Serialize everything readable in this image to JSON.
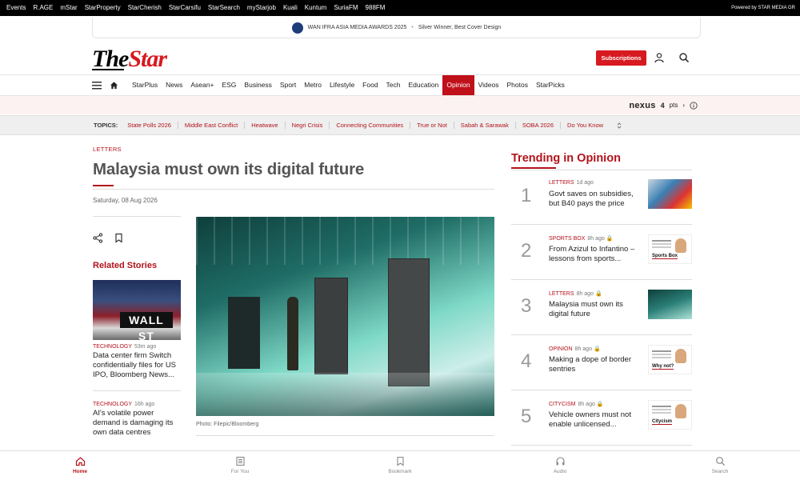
{
  "topbar": {
    "links": [
      "Events",
      "R.AGE",
      "mStar",
      "StarProperty",
      "StarCherish",
      "StarCarsifu",
      "StarSearch",
      "myStarjob",
      "Kuali",
      "Kuntum",
      "SuriaFM",
      "988FM"
    ],
    "powered_by": "Powered by STAR MEDIA GR"
  },
  "award_banner": {
    "title": "WAN IFRA ASIA MEDIA AWARDS 2025",
    "separator": "•",
    "subtitle": "Silver Winner, Best Cover Design"
  },
  "header": {
    "logo_the": "The",
    "logo_star": "Star",
    "subscriptions_label": "Subscriptions"
  },
  "nav": {
    "items": [
      "StarPlus",
      "News",
      "Asean+",
      "ESG",
      "Business",
      "Sport",
      "Metro",
      "Lifestyle",
      "Food",
      "Tech",
      "Education",
      "Opinion",
      "Videos",
      "Photos",
      "StarPicks"
    ],
    "active": "Opinion"
  },
  "nexus": {
    "brand": "nexus",
    "points": "4",
    "points_label": "pts",
    "arrow": "›"
  },
  "topics": {
    "label": "TOPICS:",
    "items": [
      "State Polls 2026",
      "Middle East Conflict",
      "Heatwave",
      "Negri Crisis",
      "Connecting Communities",
      "True or Not",
      "Sabah & Sarawak",
      "SOBA 2026",
      "Do You Know"
    ]
  },
  "article": {
    "kicker": "LETTERS",
    "headline": "Malaysia must own its digital future",
    "date": "Saturday, 08 Aug 2026",
    "photo_caption": "Photo: Filepic/Bloomberg"
  },
  "related": {
    "title": "Related Stories",
    "thumb_sign": "WALL ST",
    "items": [
      {
        "tag": "TECHNOLOGY",
        "ago": "53m ago",
        "title": "Data center firm Switch confidentially files for US IPO, Bloomberg News..."
      },
      {
        "tag": "TECHNOLOGY",
        "ago": "16h ago",
        "title": "AI's volatile power demand is damaging its own data centres"
      }
    ]
  },
  "trending": {
    "title": "Trending in Opinion",
    "items": [
      {
        "num": "1",
        "tag": "LETTERS",
        "ago": "1d ago",
        "locked": false,
        "title": "Govt saves on subsidies, but B40 pays the price"
      },
      {
        "num": "2",
        "tag": "SPORTS BOX",
        "ago": "8h ago",
        "locked": true,
        "title": "From Azizul to Infantino – lessons from sports...",
        "thumb_label": "Sports Box"
      },
      {
        "num": "3",
        "tag": "LETTERS",
        "ago": "8h ago",
        "locked": true,
        "title": "Malaysia must own its digital future"
      },
      {
        "num": "4",
        "tag": "OPINION",
        "ago": "8h ago",
        "locked": true,
        "title": "Making a dope of border sentries",
        "thumb_label": "Why not?"
      },
      {
        "num": "5",
        "tag": "CITYCISM",
        "ago": "8h ago",
        "locked": true,
        "title": "Vehicle owners must not enable unlicensed...",
        "thumb_label": "Citycism"
      }
    ]
  },
  "bottom_nav": {
    "items": [
      {
        "label": "Home",
        "icon": "home-icon"
      },
      {
        "label": "For You",
        "icon": "for-you-icon"
      },
      {
        "label": "Bookmark",
        "icon": "bookmark-icon"
      },
      {
        "label": "Audio",
        "icon": "headphones-icon"
      },
      {
        "label": "Search",
        "icon": "search-icon"
      }
    ],
    "active": "Home"
  },
  "colors": {
    "brand_red": "#d71920",
    "link_red": "#b3121b",
    "topbar_bg": "#000000"
  }
}
